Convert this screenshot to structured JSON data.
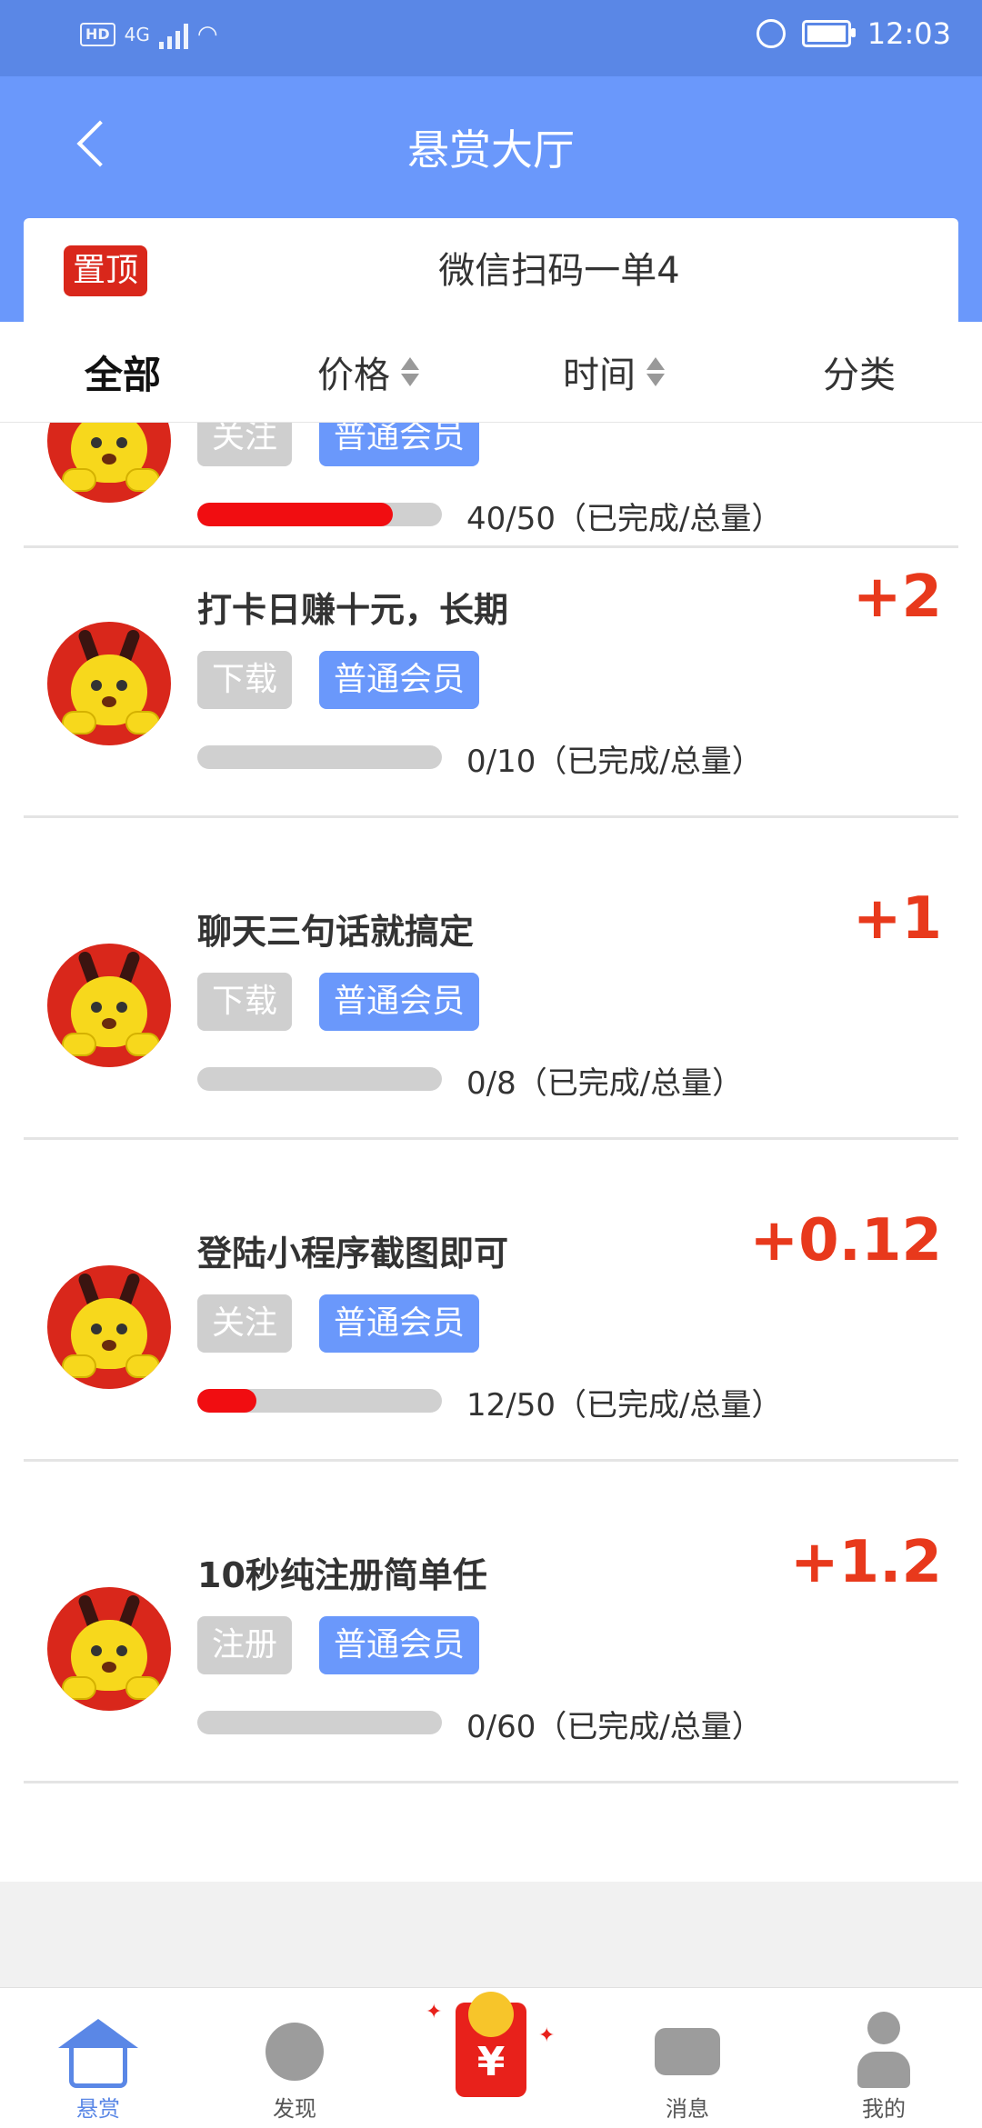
{
  "status_bar": {
    "network": "HD",
    "signal": "4G",
    "time": "12:03"
  },
  "header": {
    "title": "悬赏大厅"
  },
  "notice": {
    "badge": "置顶",
    "text": "微信扫码一单4"
  },
  "filters": [
    {
      "label": "全部",
      "active": true
    },
    {
      "label": "价格",
      "sortable": true
    },
    {
      "label": "时间",
      "sortable": true
    },
    {
      "label": "分类"
    }
  ],
  "tasks": [
    {
      "title": "",
      "reward": "",
      "tag": "关注",
      "level": "普通会员",
      "progress": 0.8,
      "progress_text": "40/50（已完成/总量）"
    },
    {
      "title": "打卡日赚十元，长期",
      "reward": "+2",
      "tag": "下载",
      "level": "普通会员",
      "progress": 0,
      "progress_text": "0/10（已完成/总量）"
    },
    {
      "title": "聊天三句话就搞定",
      "reward": "+1",
      "tag": "下载",
      "level": "普通会员",
      "progress": 0,
      "progress_text": "0/8（已完成/总量）"
    },
    {
      "title": "登陆小程序截图即可",
      "reward": "+0.12",
      "tag": "关注",
      "level": "普通会员",
      "progress": 0.24,
      "progress_text": "12/50（已完成/总量）"
    },
    {
      "title": "10秒纯注册简单任",
      "reward": "+1.2",
      "tag": "注册",
      "level": "普通会员",
      "progress": 0,
      "progress_text": "0/60（已完成/总量）"
    }
  ],
  "tabbar": [
    {
      "label": "悬赏",
      "icon": "house-icon",
      "active": true
    },
    {
      "label": "发现",
      "icon": "compass-icon"
    },
    {
      "label": "",
      "icon": "red-packet-icon",
      "symbol": "¥"
    },
    {
      "label": "消息",
      "icon": "chat-bubble-icon"
    },
    {
      "label": "我的",
      "icon": "user-icon"
    }
  ],
  "colors": {
    "primary": "#6a98fb",
    "status_bar": "#5a87e6",
    "reward": "#e8391c",
    "progress_fill": "#f10d11",
    "pin_badge": "#d9271b"
  }
}
